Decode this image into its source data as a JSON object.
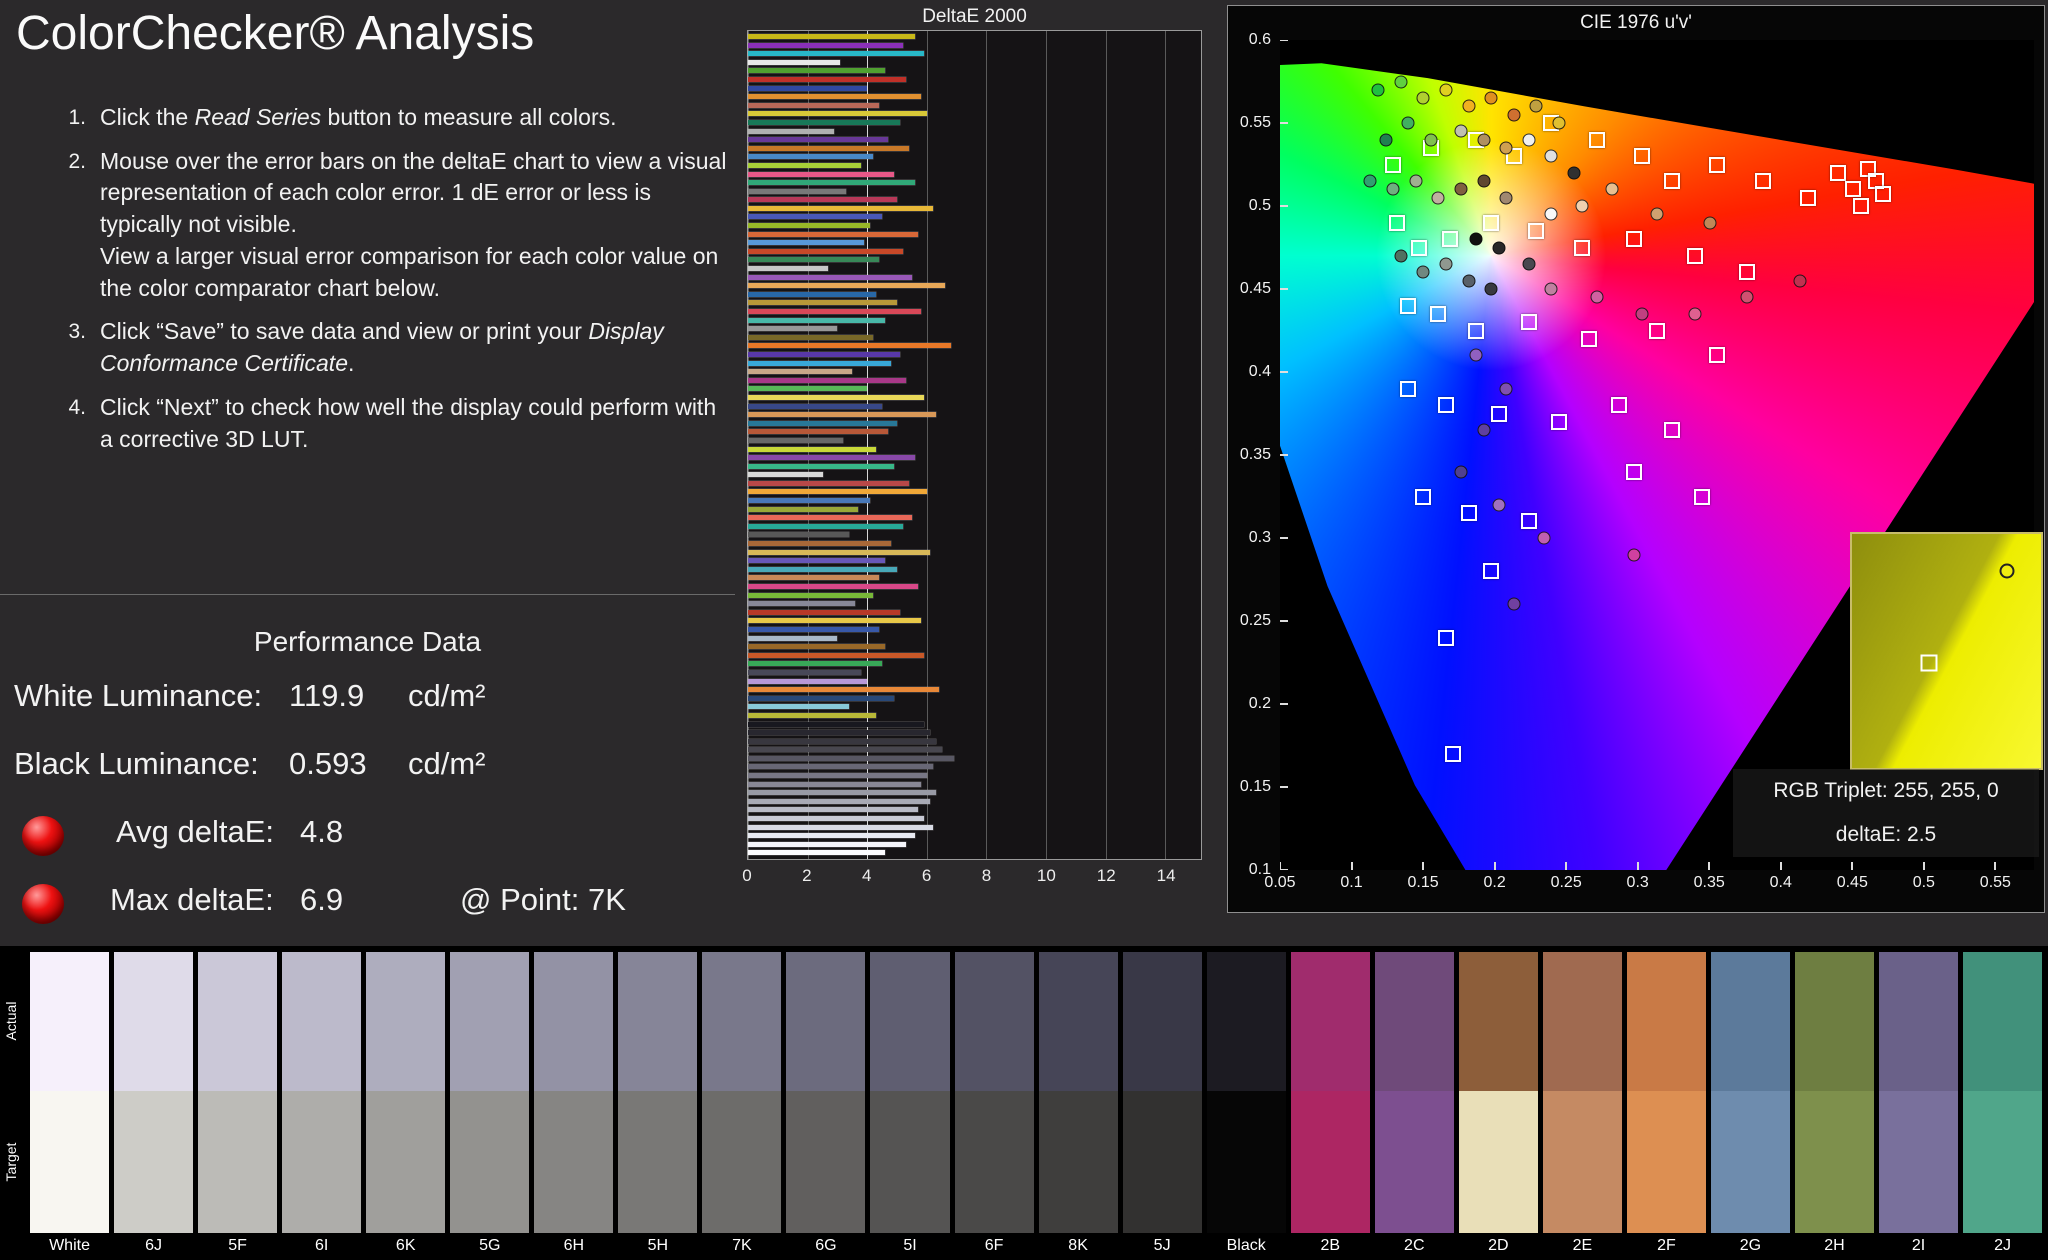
{
  "header": {
    "title": "ColorChecker® Analysis"
  },
  "instructions": [
    {
      "num": "1.",
      "segments": [
        {
          "t": "Click the "
        },
        {
          "t": "Read Series",
          "i": true
        },
        {
          "t": " button to measure all colors."
        }
      ]
    },
    {
      "num": "2.",
      "segments": [
        {
          "t": "Mouse over the error bars on the deltaE chart to view a visual representation of each color error. 1 dE error or less is typically not visible.\nView a larger visual error comparison for each color value on the color comparator chart below."
        }
      ]
    },
    {
      "num": "3.",
      "segments": [
        {
          "t": "Click “Save” to save data and view or print your "
        },
        {
          "t": "Display Conformance Certificate",
          "i": true
        },
        {
          "t": "."
        }
      ]
    },
    {
      "num": "4.",
      "segments": [
        {
          "t": "Click “Next” to check how well the display could perform with a corrective 3D LUT."
        }
      ]
    }
  ],
  "performance": {
    "heading": "Performance Data",
    "led_color": "#cc0000",
    "rows": [
      {
        "label": "White Luminance:",
        "value": "119.9",
        "unit": "cd/m²"
      },
      {
        "label": "Black Luminance:",
        "value": "0.593",
        "unit": "cd/m²"
      },
      {
        "label": "Avg deltaE:",
        "value": "4.8"
      },
      {
        "label": "Max deltaE:",
        "value": "6.9",
        "extra": "@ Point: 7K"
      }
    ]
  },
  "delta_chart": {
    "title": "DeltaE 2000",
    "max": 15.2,
    "ticks": [
      0,
      2,
      4,
      6,
      8,
      10,
      12,
      14
    ],
    "avg_line": 4,
    "bars": [
      {
        "c": "#c8b818",
        "v": 5.6
      },
      {
        "c": "#8a30b8",
        "v": 5.2
      },
      {
        "c": "#28b8c8",
        "v": 5.9
      },
      {
        "c": "#e8e8e8",
        "v": 3.1
      },
      {
        "c": "#50a030",
        "v": 4.6
      },
      {
        "c": "#c03028",
        "v": 5.3
      },
      {
        "c": "#3048a0",
        "v": 4.0
      },
      {
        "c": "#e09030",
        "v": 5.8
      },
      {
        "c": "#b86858",
        "v": 4.4
      },
      {
        "c": "#d8c838",
        "v": 6.0
      },
      {
        "c": "#187858",
        "v": 5.1
      },
      {
        "c": "#b0b0b0",
        "v": 2.9
      },
      {
        "c": "#683898",
        "v": 4.7
      },
      {
        "c": "#c87828",
        "v": 5.4
      },
      {
        "c": "#4888c8",
        "v": 4.2
      },
      {
        "c": "#a8d038",
        "v": 3.8
      },
      {
        "c": "#e85888",
        "v": 4.9
      },
      {
        "c": "#30a878",
        "v": 5.6
      },
      {
        "c": "#787878",
        "v": 3.3
      },
      {
        "c": "#b83858",
        "v": 5.0
      },
      {
        "c": "#e8b838",
        "v": 6.2
      },
      {
        "c": "#4858b8",
        "v": 4.5
      },
      {
        "c": "#98b828",
        "v": 4.1
      },
      {
        "c": "#d86838",
        "v": 5.7
      },
      {
        "c": "#5898d8",
        "v": 3.9
      },
      {
        "c": "#c84828",
        "v": 5.2
      },
      {
        "c": "#388858",
        "v": 4.4
      },
      {
        "c": "#c8c8c8",
        "v": 2.7
      },
      {
        "c": "#9858b8",
        "v": 5.5
      },
      {
        "c": "#e8a858",
        "v": 6.6
      },
      {
        "c": "#2868a8",
        "v": 4.3
      },
      {
        "c": "#b89838",
        "v": 5.0
      },
      {
        "c": "#d84858",
        "v": 5.8
      },
      {
        "c": "#48b8a8",
        "v": 4.6
      },
      {
        "c": "#989898",
        "v": 3.0
      },
      {
        "c": "#786828",
        "v": 4.2
      },
      {
        "c": "#e87828",
        "v": 6.8
      },
      {
        "c": "#5838a8",
        "v": 5.1
      },
      {
        "c": "#38a8d8",
        "v": 4.8
      },
      {
        "c": "#c8a888",
        "v": 3.5
      },
      {
        "c": "#a83888",
        "v": 5.3
      },
      {
        "c": "#58b858",
        "v": 4.0
      },
      {
        "c": "#e8d858",
        "v": 5.9
      },
      {
        "c": "#384888",
        "v": 4.5
      },
      {
        "c": "#d89858",
        "v": 6.3
      },
      {
        "c": "#287898",
        "v": 5.0
      },
      {
        "c": "#b85838",
        "v": 4.7
      },
      {
        "c": "#686868",
        "v": 3.2
      },
      {
        "c": "#c8d838",
        "v": 4.3
      },
      {
        "c": "#8848a8",
        "v": 5.6
      },
      {
        "c": "#38b888",
        "v": 4.9
      },
      {
        "c": "#d8d8d8",
        "v": 2.5
      },
      {
        "c": "#b84848",
        "v": 5.4
      },
      {
        "c": "#f0a838",
        "v": 6.0
      },
      {
        "c": "#4878b8",
        "v": 4.1
      },
      {
        "c": "#98a838",
        "v": 3.7
      },
      {
        "c": "#e86858",
        "v": 5.5
      },
      {
        "c": "#28a898",
        "v": 5.2
      },
      {
        "c": "#585858",
        "v": 3.4
      },
      {
        "c": "#a86838",
        "v": 4.8
      },
      {
        "c": "#d8b858",
        "v": 6.1
      },
      {
        "c": "#6858b8",
        "v": 4.6
      },
      {
        "c": "#48a8b8",
        "v": 5.0
      },
      {
        "c": "#c88858",
        "v": 4.4
      },
      {
        "c": "#d84888",
        "v": 5.7
      },
      {
        "c": "#78b838",
        "v": 4.2
      },
      {
        "c": "#888898",
        "v": 3.6
      },
      {
        "c": "#b83828",
        "v": 5.1
      },
      {
        "c": "#e8c848",
        "v": 5.8
      },
      {
        "c": "#3858a8",
        "v": 4.4
      },
      {
        "c": "#a8b8c8",
        "v": 3.0
      },
      {
        "c": "#986828",
        "v": 4.6
      },
      {
        "c": "#c85828",
        "v": 5.9
      },
      {
        "c": "#38a858",
        "v": 4.5
      },
      {
        "c": "#484858",
        "v": 3.8
      },
      {
        "c": "#b898d8",
        "v": 4.0
      },
      {
        "c": "#e88838",
        "v": 6.4
      },
      {
        "c": "#284878",
        "v": 4.9
      },
      {
        "c": "#88c8d8",
        "v": 3.4
      },
      {
        "c": "#b8b838",
        "v": 4.3
      },
      {
        "c": "#18181f",
        "v": 5.9
      },
      {
        "c": "#28272f",
        "v": 6.1
      },
      {
        "c": "#38373f",
        "v": 6.3
      },
      {
        "c": "#48474f",
        "v": 6.5
      },
      {
        "c": "#585763",
        "v": 6.9
      },
      {
        "c": "#686775",
        "v": 6.2
      },
      {
        "c": "#787785",
        "v": 6.0
      },
      {
        "c": "#888795",
        "v": 5.8
      },
      {
        "c": "#989aa5",
        "v": 6.3
      },
      {
        "c": "#a8aab5",
        "v": 6.1
      },
      {
        "c": "#b8bac5",
        "v": 5.7
      },
      {
        "c": "#c8cad5",
        "v": 5.9
      },
      {
        "c": "#d8dae5",
        "v": 6.2
      },
      {
        "c": "#e8eaf2",
        "v": 5.6
      },
      {
        "c": "#f4f4fa",
        "v": 5.3
      },
      {
        "c": "#fcfcff",
        "v": 4.6
      }
    ]
  },
  "cie_chart": {
    "title": "CIE 1976 u'v'",
    "x_ticks": [
      "0.05",
      "0.1",
      "0.15",
      "0.2",
      "0.25",
      "0.3",
      "0.35",
      "0.4",
      "0.45",
      "0.5",
      "0.55"
    ],
    "y_ticks": [
      "0.6",
      "0.55",
      "0.5",
      "0.45",
      "0.4",
      "0.35",
      "0.3",
      "0.25",
      "0.2",
      "0.15",
      "0.1"
    ],
    "x_range": [
      0.05,
      0.577
    ],
    "y_range": [
      0.1,
      0.6
    ],
    "squares": [
      [
        15,
        15
      ],
      [
        20,
        13
      ],
      [
        26,
        12
      ],
      [
        31,
        14
      ],
      [
        36,
        10
      ],
      [
        42,
        12
      ],
      [
        48,
        14
      ],
      [
        52,
        17
      ],
      [
        58,
        15
      ],
      [
        64,
        17
      ],
      [
        70,
        19
      ],
      [
        74,
        16
      ],
      [
        76,
        18
      ],
      [
        78,
        15.5
      ],
      [
        79,
        17
      ],
      [
        80,
        18.5
      ],
      [
        77,
        20
      ],
      [
        15.5,
        22
      ],
      [
        18.5,
        25
      ],
      [
        22.5,
        24
      ],
      [
        28,
        22
      ],
      [
        34,
        23
      ],
      [
        40,
        25
      ],
      [
        47,
        24
      ],
      [
        55,
        26
      ],
      [
        62,
        28
      ],
      [
        17,
        32
      ],
      [
        21,
        33
      ],
      [
        26,
        35
      ],
      [
        33,
        34
      ],
      [
        41,
        36
      ],
      [
        50,
        35
      ],
      [
        58,
        38
      ],
      [
        17,
        42
      ],
      [
        22,
        44
      ],
      [
        29,
        45
      ],
      [
        37,
        46
      ],
      [
        45,
        44
      ],
      [
        52,
        47
      ],
      [
        19,
        55
      ],
      [
        25,
        57
      ],
      [
        33,
        58
      ],
      [
        28,
        64
      ],
      [
        22,
        72
      ],
      [
        23,
        86
      ],
      [
        47,
        52
      ],
      [
        56,
        55
      ]
    ],
    "circles": [
      [
        13,
        6,
        "#20c040"
      ],
      [
        16,
        5,
        "#60d040"
      ],
      [
        19,
        7,
        "#b0d030"
      ],
      [
        22,
        6,
        "#e0d020"
      ],
      [
        25,
        8,
        "#f0b020"
      ],
      [
        28,
        7,
        "#e09020"
      ],
      [
        31,
        9,
        "#d07030"
      ],
      [
        34,
        8,
        "#c0a040"
      ],
      [
        37,
        10,
        "#e0c030"
      ],
      [
        24,
        11,
        "#c0c0b0"
      ],
      [
        27,
        12,
        "#b09060"
      ],
      [
        30,
        13,
        "#d0a050"
      ],
      [
        33,
        12,
        "#f0f0f0"
      ],
      [
        36,
        14,
        "#e0e0e0"
      ],
      [
        20,
        12,
        "#80c050"
      ],
      [
        17,
        10,
        "#40b060"
      ],
      [
        14,
        12,
        "#208050"
      ],
      [
        12,
        17,
        "#30a070"
      ],
      [
        15,
        18,
        "#70b080"
      ],
      [
        18,
        17,
        "#a0b090"
      ],
      [
        21,
        19,
        "#c0b0a0"
      ],
      [
        24,
        18,
        "#806040"
      ],
      [
        27,
        17,
        "#604830"
      ],
      [
        30,
        19,
        "#a08870"
      ],
      [
        16,
        26,
        "#507060"
      ],
      [
        19,
        28,
        "#708880"
      ],
      [
        22,
        27,
        "#909890"
      ],
      [
        25,
        29,
        "#586068"
      ],
      [
        28,
        30,
        "#383840"
      ],
      [
        26,
        24,
        "#101010"
      ],
      [
        29,
        25,
        "#282828"
      ],
      [
        33,
        27,
        "#484850"
      ],
      [
        36,
        30,
        "#c080a0"
      ],
      [
        42,
        31,
        "#d060a0"
      ],
      [
        48,
        33,
        "#c04080"
      ],
      [
        55,
        33,
        "#e06090"
      ],
      [
        62,
        31,
        "#d05070"
      ],
      [
        69,
        29,
        "#c03050"
      ],
      [
        26,
        38,
        "#9060c0"
      ],
      [
        30,
        42,
        "#8050b0"
      ],
      [
        27,
        47,
        "#6040a0"
      ],
      [
        24,
        52,
        "#504090"
      ],
      [
        29,
        56,
        "#a070c0"
      ],
      [
        35,
        60,
        "#c060b0"
      ],
      [
        47,
        62,
        "#d040a0"
      ],
      [
        31,
        68,
        "#7040a0"
      ],
      [
        40,
        20,
        "#f0d0b0"
      ],
      [
        44,
        18,
        "#e8c090"
      ],
      [
        50,
        21,
        "#d0a070"
      ],
      [
        57,
        22,
        "#c08858"
      ],
      [
        36,
        21,
        "#f8f8f8"
      ],
      [
        39,
        16,
        "#303030"
      ]
    ],
    "inset": {
      "rgb_line": "RGB Triplet: 255, 255, 0",
      "delta_line": "deltaE: 2.5"
    }
  },
  "comparator": {
    "row_labels": [
      "Actual",
      "Target"
    ],
    "columns": [
      {
        "label": "White",
        "actual": "#f6f0fb",
        "target": "#f8f6f1"
      },
      {
        "label": "6J",
        "actual": "#dfdbe9",
        "target": "#cdccc7"
      },
      {
        "label": "5F",
        "actual": "#cbc8d8",
        "target": "#bcbbb7"
      },
      {
        "label": "6I",
        "actual": "#bcbacb",
        "target": "#aeadaa"
      },
      {
        "label": "6K",
        "actual": "#aeadbe",
        "target": "#a09f9c"
      },
      {
        "label": "5G",
        "actual": "#a1a0b2",
        "target": "#93928f"
      },
      {
        "label": "6H",
        "actual": "#9392a5",
        "target": "#868583"
      },
      {
        "label": "5H",
        "actual": "#868598",
        "target": "#797876"
      },
      {
        "label": "7K",
        "actual": "#79788b",
        "target": "#6d6c6a"
      },
      {
        "label": "6G",
        "actual": "#6c6b7e",
        "target": "#615f5e"
      },
      {
        "label": "5I",
        "actual": "#5f5e71",
        "target": "#555453"
      },
      {
        "label": "6F",
        "actual": "#535264",
        "target": "#4a4948"
      },
      {
        "label": "8K",
        "actual": "#464557",
        "target": "#3f3e3d"
      },
      {
        "label": "5J",
        "actual": "#393847",
        "target": "#323130"
      },
      {
        "label": "Black",
        "actual": "#1c1b22",
        "target": "#060606"
      },
      {
        "label": "2B",
        "actual": "#a02c6d",
        "target": "#ad2663"
      },
      {
        "label": "2C",
        "actual": "#6f4a7a",
        "target": "#7d4f90"
      },
      {
        "label": "2D",
        "actual": "#8d5e3a",
        "target": "#e9dfb8"
      },
      {
        "label": "2E",
        "actual": "#a06a50",
        "target": "#c58a63"
      },
      {
        "label": "2F",
        "actual": "#c97a46",
        "target": "#dd8f52"
      },
      {
        "label": "2G",
        "actual": "#5c7a9b",
        "target": "#6e8cae"
      },
      {
        "label": "2H",
        "actual": "#6e7e41",
        "target": "#7e904c"
      },
      {
        "label": "2I",
        "actual": "#6a6189",
        "target": "#79709c"
      },
      {
        "label": "2J",
        "actual": "#41917b",
        "target": "#50a68a"
      }
    ]
  }
}
